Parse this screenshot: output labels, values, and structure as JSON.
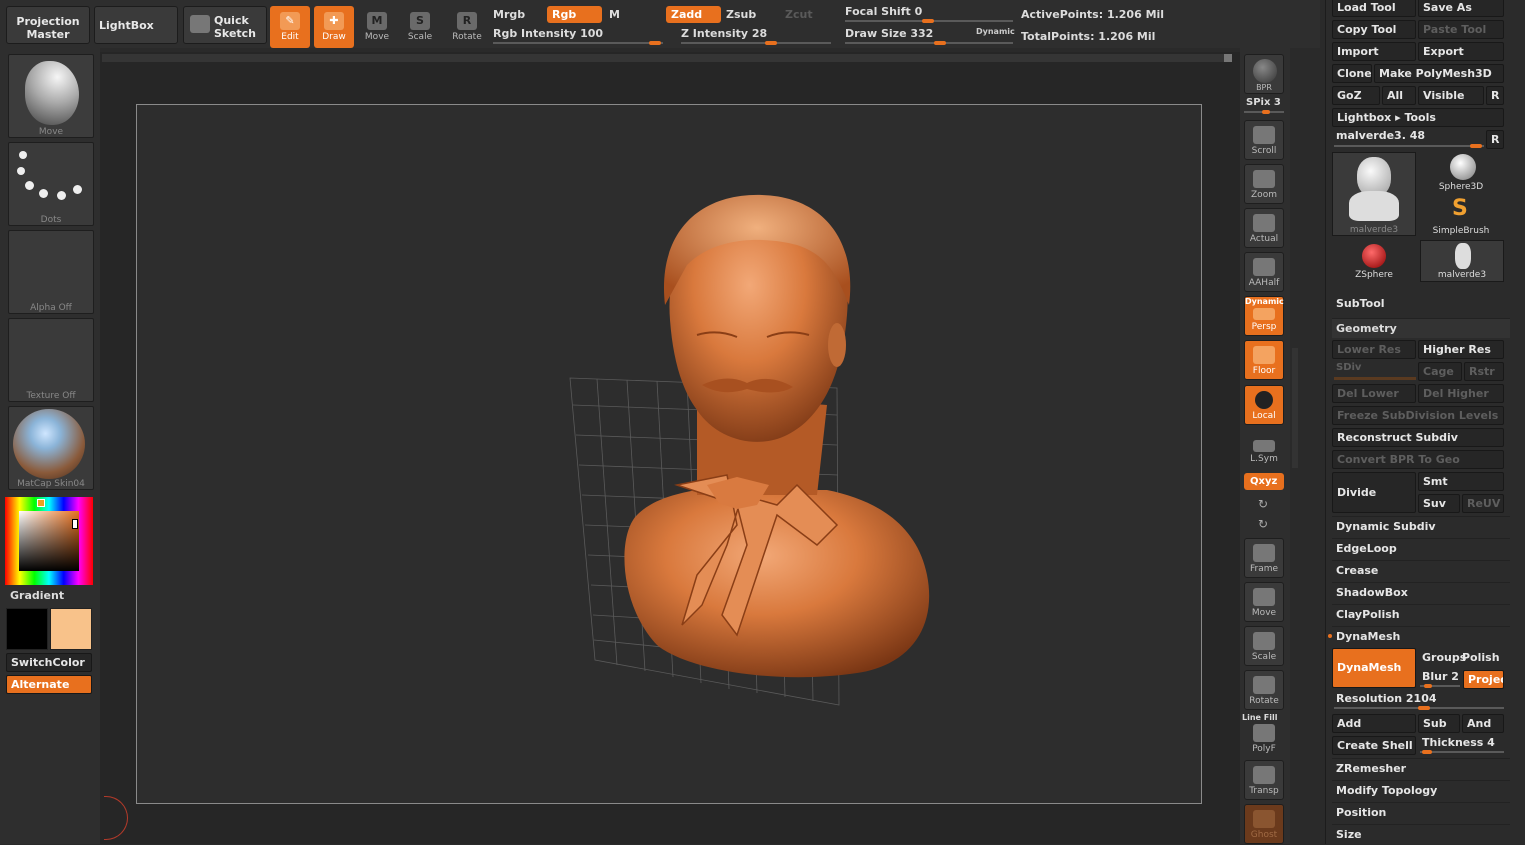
{
  "topbar": {
    "projection_master": "Projection Master",
    "lightbox": "LightBox",
    "quick_sketch": "Quick Sketch",
    "tools": [
      {
        "label": "Edit",
        "glyph": "✎",
        "on": true
      },
      {
        "label": "Draw",
        "glyph": "✚",
        "on": true
      },
      {
        "label": "Move",
        "glyph": "M",
        "on": false
      },
      {
        "label": "Scale",
        "glyph": "S",
        "on": false
      },
      {
        "label": "Rotate",
        "glyph": "R",
        "on": false
      }
    ],
    "mrgb": "Mrgb",
    "rgb": "Rgb",
    "m": "M",
    "zadd": "Zadd",
    "zsub": "Zsub",
    "zcut": "Zcut",
    "rgb_intensity": "Rgb Intensity 100",
    "z_intensity": "Z Intensity 28",
    "focal_shift": "Focal Shift 0",
    "draw_size": "Draw Size 332",
    "dynamic": "Dynamic",
    "active_points": "ActivePoints: 1.206 Mil",
    "total_points": "TotalPoints: 1.206 Mil"
  },
  "left": {
    "brush": "Move",
    "stroke": "Dots",
    "alpha": "Alpha Off",
    "texture": "Texture Off",
    "material": "MatCap Skin04",
    "gradient": "Gradient",
    "switch_color": "SwitchColor",
    "alternate": "Alternate"
  },
  "right": {
    "bpr": "BPR",
    "spix": "SPix 3",
    "buttons": [
      "Scroll",
      "Zoom",
      "Actual",
      "AAHalf",
      "Persp",
      "Floor",
      "Local",
      "L.Sym",
      "Frame",
      "Move",
      "Scale",
      "Rotate",
      "PolyF",
      "Transp",
      "Ghost"
    ],
    "dynamic": "Dynamic",
    "xyz": "Qxyz",
    "line_fill": "Line Fill"
  },
  "panel": {
    "load_tool": "Load Tool",
    "save_as": "Save As",
    "copy_tool": "Copy Tool",
    "paste_tool": "Paste Tool",
    "import": "Import",
    "export": "Export",
    "clone": "Clone",
    "make_polymesh": "Make PolyMesh3D",
    "goz": "GoZ",
    "all": "All",
    "visible": "Visible",
    "r": "R",
    "lightbox_tools": "Lightbox ▸ Tools",
    "current_tool": "malverde3. 48",
    "tool_thumbs": [
      "malverde3",
      "Sphere3D",
      "SimpleBrush",
      "ZSphere",
      "malverde3"
    ],
    "subtool": "SubTool",
    "geometry": "Geometry",
    "lower_res": "Lower Res",
    "higher_res": "Higher Res",
    "sdiv": "SDiv",
    "cage": "Cage",
    "rstr": "Rstr",
    "del_lower": "Del Lower",
    "del_higher": "Del Higher",
    "freeze": "Freeze SubDivision Levels",
    "reconstruct": "Reconstruct Subdiv",
    "convert_bpr": "Convert BPR To Geo",
    "divide": "Divide",
    "smt": "Smt",
    "suv": "Suv",
    "reuv": "ReUV",
    "sections": [
      "Dynamic Subdiv",
      "EdgeLoop",
      "Crease",
      "ShadowBox",
      "ClayPolish",
      "DynaMesh"
    ],
    "dynamesh_btn": "DynaMesh",
    "groups": "Groups",
    "polish": "Polish",
    "blur": "Blur 2",
    "project": "Projec",
    "resolution": "Resolution 2104",
    "add": "Add",
    "sub": "Sub",
    "and": "And",
    "create_shell": "Create Shell",
    "thickness": "Thickness 4",
    "bottom_sections": [
      "ZRemesher",
      "Modify Topology",
      "Position",
      "Size"
    ]
  },
  "colors": {
    "accent": "#e8701e",
    "secondary_color": "#f8c28a",
    "main_color": "#000000"
  }
}
